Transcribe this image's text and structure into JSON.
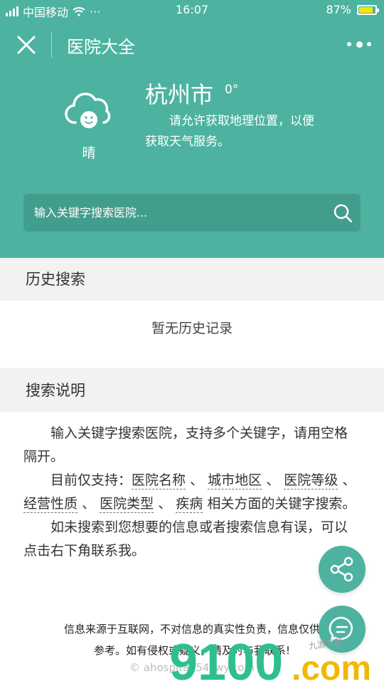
{
  "status_bar": {
    "carrier": "中国移动",
    "dots": "···",
    "time": "16:07",
    "battery_percent": "87%",
    "battery_level": 0.87
  },
  "nav": {
    "title": "医院大全"
  },
  "weather": {
    "icon": "cloud-smile-icon",
    "description": "晴",
    "city": "杭州市",
    "temperature": "0°",
    "location_message": "请允许获取地理位置，以便获取天气服务。"
  },
  "search": {
    "placeholder": "输入关键字搜索医院..."
  },
  "history": {
    "heading": "历史搜索",
    "empty_text": "暂无历史记录"
  },
  "instructions": {
    "heading": "搜索说明",
    "para1": "输入关键字搜索医院，支持多个关键字，请用空格隔开。",
    "para2_prefix": "目前仅支持：",
    "tags": [
      "医院名称",
      "城市地区",
      "医院等级",
      "经营性质",
      "医院类型",
      "疾病"
    ],
    "separator": "、",
    "para2_suffix": "相关方面的关键字搜索。",
    "para3": "如未搜索到您想要的信息或者搜索信息有误，可以点击右下角联系我。"
  },
  "footer": {
    "disclaimer_line1": "信息来源于互联网，不对信息的真实性负责，信息仅供",
    "disclaimer_line2": "参考。如有侵权或疑义，请及时与我联系!",
    "copyright": "© ahospital.54zwy.com"
  },
  "watermark": {
    "text_main": "9100",
    "text_dot": ".com",
    "text_small": "九游下载"
  },
  "colors": {
    "primary": "#4db3a0",
    "background": "#f2f2f2",
    "watermark_green": "#2fbf8f",
    "watermark_yellow": "#f2b800"
  }
}
